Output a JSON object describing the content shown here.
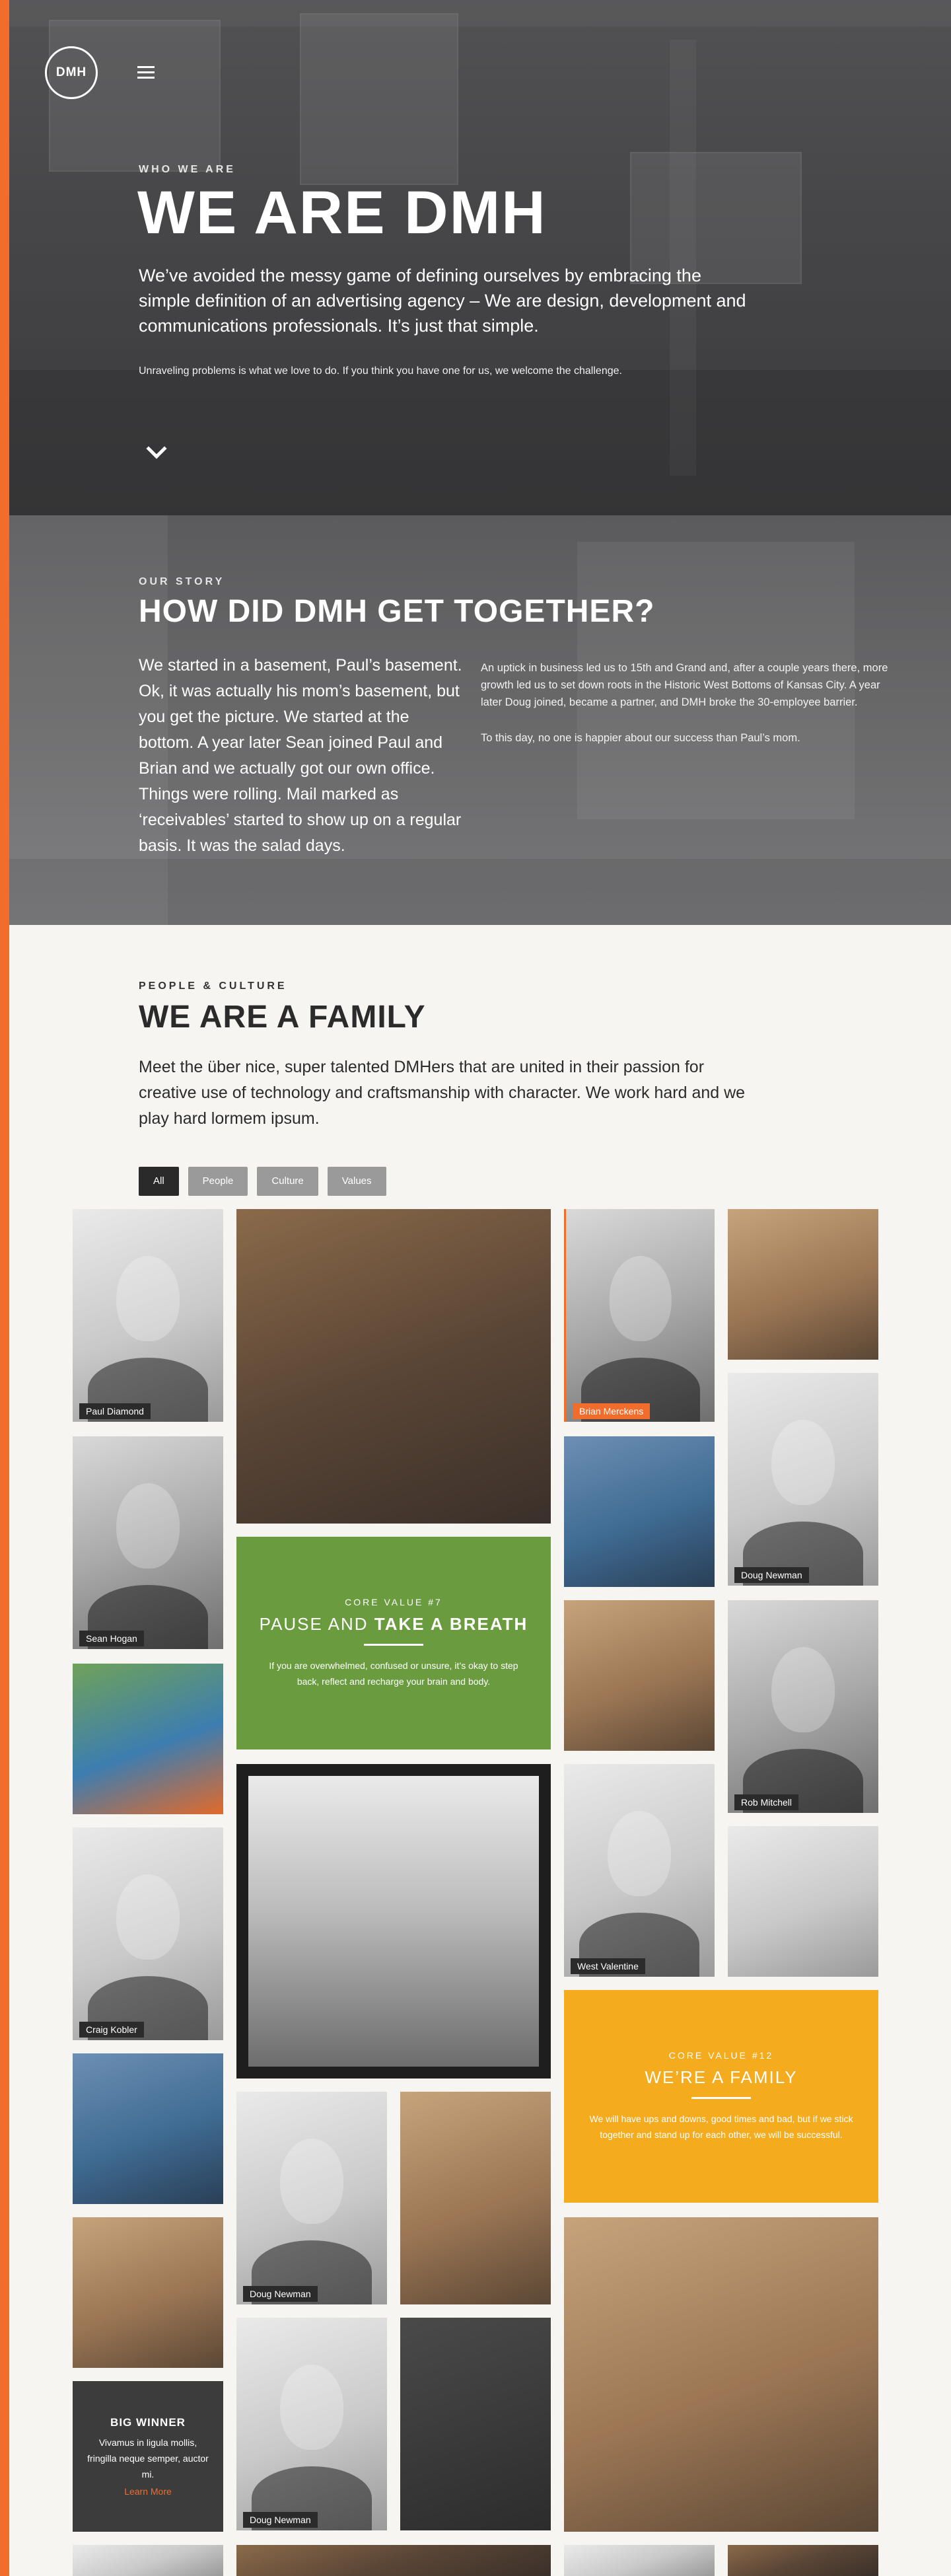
{
  "brand": {
    "logo_text": "DMH",
    "accent": "#f26c2b"
  },
  "hero": {
    "eyebrow": "WHO WE ARE",
    "title": "WE ARE DMH",
    "lead": "We’ve avoided the messy game of defining ourselves by embracing the simple definition of an advertising agency – We are design, development and communications professionals. It’s just that simple.",
    "sub": "Unraveling problems is what we love to do. If you think you have one for us, we welcome the challenge."
  },
  "story": {
    "eyebrow": "OUR STORY",
    "title": "HOW DID DMH GET TOGETHER?",
    "left": "We started in a basement, Paul’s basement. Ok, it was actually his mom’s basement, but you get the picture. We started at the bottom. A year later Sean joined Paul and Brian and we actually got our own office. Things were rolling. Mail marked as ‘receivables’ started to show up on a regular basis. It was the salad days.",
    "right_p1": "An uptick in business led us to 15th and Grand and, after a couple years there, more growth led us to set down roots in the Historic West Bottoms of Kansas City. A year later Doug joined, became a partner, and DMH broke the 30-employee barrier.",
    "right_p2": "To this day, no one is happier about our success than Paul’s mom."
  },
  "family": {
    "eyebrow": "PEOPLE & CULTURE",
    "title": "WE ARE A FAMILY",
    "intro": "Meet the über nice, super talented DMHers that are united in their passion for creative use of technology and craftsmanship with character. We work hard and we play hard lormem ipsum.",
    "filters": [
      "All",
      "People",
      "Culture",
      "Values"
    ]
  },
  "tiles": {
    "paul_diamond": "Paul Diamond",
    "brian_merckens": "Brian Merckens",
    "sean_hogan": "Sean Hogan",
    "doug_newman": "Doug Newman",
    "rob_mitchell": "Rob Mitchell",
    "craig_kobler": "Craig Kobler",
    "west_valentine": "West Valentine",
    "doug_newman_2": "Doug Newman",
    "doug_newman_3": "Doug Newman",
    "core7": {
      "kicker": "CORE VALUE #7",
      "head_plain": "PAUSE AND ",
      "head_bold": "TAKE A BREATH",
      "body": "If you are overwhelmed, confused or unsure, it’s okay to step back, reflect and recharge your brain and body.",
      "color": "#6a9c3f"
    },
    "core12": {
      "kicker": "CORE VALUE #12",
      "head": "WE’RE A FAMILY",
      "body": "We will have ups and downs, good times and bad, but if we stick together and stand up for each other, we will be successful.",
      "color": "#f5ab1e"
    },
    "winner": {
      "head": "BIG WINNER",
      "body": "Vivamus in ligula mollis, fringilla neque semper, auctor mi.",
      "link": "Learn More"
    }
  }
}
